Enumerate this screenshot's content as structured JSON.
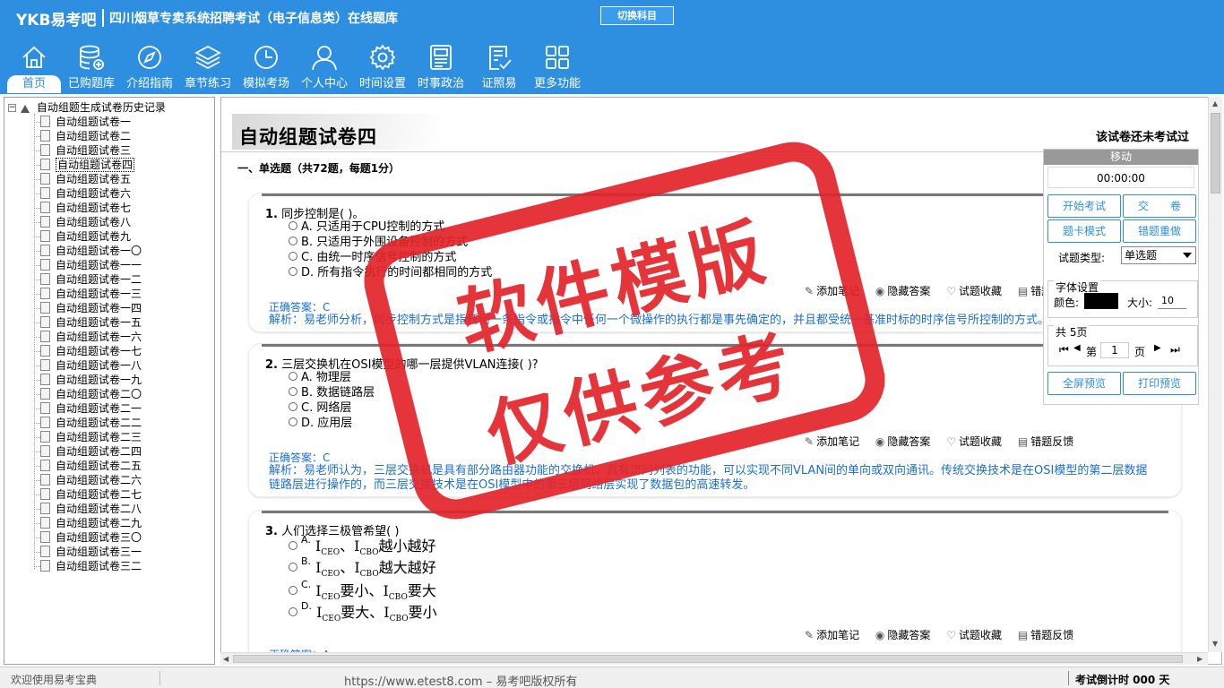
{
  "app": {
    "logo": "YKB易考吧",
    "title": "四川烟草专卖系统招聘考试（电子信息类）在线题库",
    "switch_subject": "切换科目"
  },
  "nav": [
    {
      "label": "首页",
      "icon": "home-icon",
      "active": true
    },
    {
      "label": "已购题库",
      "icon": "database-icon"
    },
    {
      "label": "介绍指南",
      "icon": "compass-icon"
    },
    {
      "label": "章节练习",
      "icon": "layers-icon"
    },
    {
      "label": "模拟考场",
      "icon": "clock-icon"
    },
    {
      "label": "个人中心",
      "icon": "user-icon"
    },
    {
      "label": "时间设置",
      "icon": "gear-icon"
    },
    {
      "label": "时事政治",
      "icon": "news-icon"
    },
    {
      "label": "证照易",
      "icon": "checklist-icon"
    },
    {
      "label": "更多功能",
      "icon": "grid-icon"
    }
  ],
  "tree": {
    "root_label": "自动组题生成试卷历史记录",
    "expander": "⊟",
    "items": [
      "自动组题试卷一",
      "自动组题试卷二",
      "自动组题试卷三",
      "自动组题试卷四",
      "自动组题试卷五",
      "自动组题试卷六",
      "自动组题试卷七",
      "自动组题试卷八",
      "自动组题试卷九",
      "自动组题试卷一〇",
      "自动组题试卷一一",
      "自动组题试卷一二",
      "自动组题试卷一三",
      "自动组题试卷一四",
      "自动组题试卷一五",
      "自动组题试卷一六",
      "自动组题试卷一七",
      "自动组题试卷一八",
      "自动组题试卷一九",
      "自动组题试卷二〇",
      "自动组题试卷二一",
      "自动组题试卷二二",
      "自动组题试卷二三",
      "自动组题试卷二四",
      "自动组题试卷二五",
      "自动组题试卷二六",
      "自动组题试卷二七",
      "自动组题试卷二八",
      "自动组题试卷二九",
      "自动组题试卷三〇",
      "自动组题试卷三一",
      "自动组题试卷三二"
    ],
    "selected_index": 3
  },
  "paper": {
    "title": "自动组题试卷四",
    "status": "该试卷还未考试过",
    "section_heading": "一、单选题（共72题，每题1分）"
  },
  "questions": [
    {
      "num": "1.",
      "text": "同步控制是( )。",
      "options": [
        "A. 只适用于CPU控制的方式",
        "B. 只适用于外围设备控制的方式",
        "C. 由统一时序信号控制的方式",
        "D. 所有指令执行的时间都相同的方式"
      ],
      "answer": "正确答案：C",
      "analysis": "解析：易老师分析，同步控制方式是指任何一条指令或指令中任何一个微操作的执行都是事先确定的，并且都受统一基准时标的时序信号所控制的方式。"
    },
    {
      "num": "2.",
      "text": "三层交换机在OSI模型的哪一层提供VLAN连接( )?",
      "options": [
        "A. 物理层",
        "B. 数据链路层",
        "C. 网络层",
        "D. 应用层"
      ],
      "answer": "正确答案：C",
      "analysis": "解析：易老师认为，三层交换机是具有部分路由器功能的交换机，具有访问列表的功能，可以实现不同VLAN间的单向或双向通讯。传统交换技术是在OSI模型的第二层数据链路层进行操作的，而三层交换技术是在OSI模型中的第三层网络层实现了数据包的高速转发。"
    },
    {
      "num": "3.",
      "text": "人们选择三极管希望( )",
      "options": [
        {
          "key": "A.",
          "i1": "I",
          "s1": "CEO",
          "sep": "、",
          "i2": "I",
          "s2": "CBO",
          "tail": "越小越好"
        },
        {
          "key": "B.",
          "i1": "I",
          "s1": "CEO",
          "sep": "、",
          "i2": "I",
          "s2": "CBO",
          "tail": "越大越好"
        },
        {
          "key": "C.",
          "i1": "I",
          "s1": "CEO",
          "sep": "要小、",
          "i2": "I",
          "s2": "CBO",
          "tail": "要大"
        },
        {
          "key": "D.",
          "i1": "I",
          "s1": "CEO",
          "sep": "要大、",
          "i2": "I",
          "s2": "CBO",
          "tail": "要小"
        }
      ],
      "answer": "正确答案：A"
    }
  ],
  "actions": {
    "note": "添加笔记",
    "hide": "隐藏答案",
    "fav": "试题收藏",
    "report": "错题反馈"
  },
  "right_panel": {
    "move": "移动",
    "timer": "00:00:00",
    "start": "开始考试",
    "submit": "交　　卷",
    "card_mode": "题卡模式",
    "redo_wrong": "错题重做",
    "qtype_label": "试题类型:",
    "qtype_value": "单选题",
    "font_title": "字体设置",
    "color_label": "颜色:",
    "font_color": "#000000",
    "size_label": "大小:",
    "size_value": "10",
    "pages_title": "共 5页",
    "page_prefix": "第",
    "page_value": "1",
    "page_suffix": "页",
    "full_preview": "全屏预览",
    "print_preview": "打印预览"
  },
  "stamp": {
    "line1": "软件模版",
    "line2": "仅供参考"
  },
  "status": {
    "left": "欢迎使用易考宝典",
    "center": "https://www.etest8.com – 易考吧版权所有",
    "right": "考试倒计时 000 天"
  },
  "colors": {
    "brand": "#2e8fe0",
    "link": "#1a6fd1",
    "stamp": "#e3242b"
  }
}
